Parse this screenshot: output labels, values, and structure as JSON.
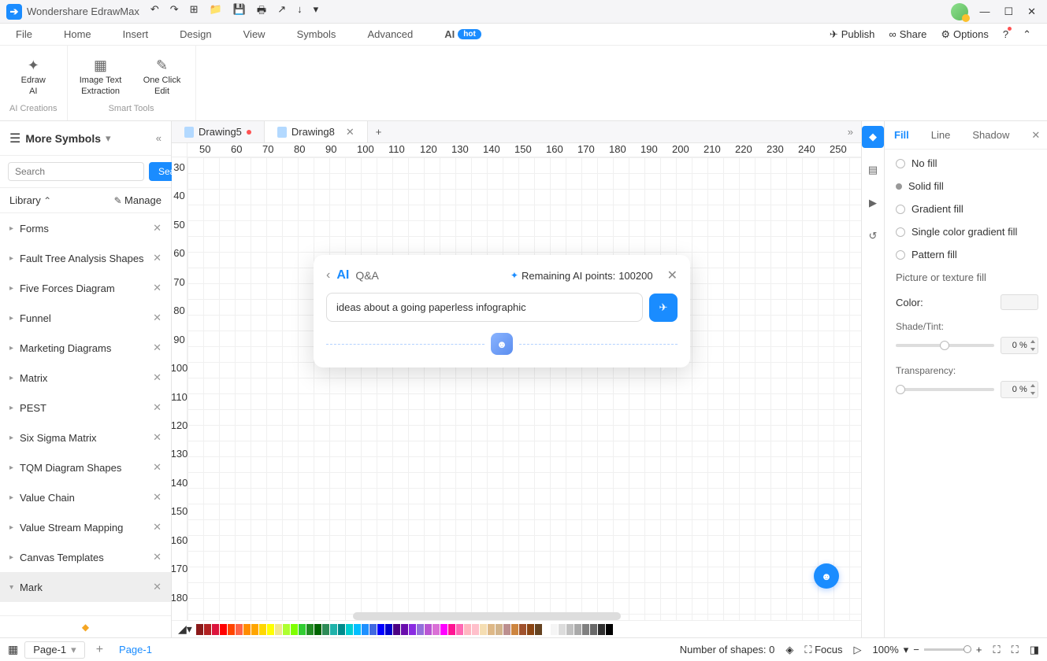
{
  "app": {
    "title": "Wondershare EdrawMax"
  },
  "menus": {
    "file": "File",
    "home": "Home",
    "insert": "Insert",
    "design": "Design",
    "view": "View",
    "symbols": "Symbols",
    "advanced": "Advanced",
    "ai": "AI",
    "hot": "hot"
  },
  "topright": {
    "publish": "Publish",
    "share": "Share",
    "options": "Options"
  },
  "ribbon": {
    "groups": [
      {
        "label": "AI Creations",
        "tools": [
          {
            "name": "edraw-ai",
            "label": "Edraw\nAI"
          }
        ]
      },
      {
        "label": "Smart Tools",
        "tools": [
          {
            "name": "image-text",
            "label": "Image Text\nExtraction"
          },
          {
            "name": "one-click",
            "label": "One Click\nEdit"
          }
        ]
      }
    ]
  },
  "leftpanel": {
    "title": "More Symbols",
    "search_placeholder": "Search",
    "search_btn": "Search",
    "library": "Library",
    "manage": "Manage",
    "items": [
      {
        "label": "Forms"
      },
      {
        "label": "Fault Tree Analysis Shapes"
      },
      {
        "label": "Five Forces Diagram"
      },
      {
        "label": "Funnel"
      },
      {
        "label": "Marketing Diagrams"
      },
      {
        "label": "Matrix"
      },
      {
        "label": "PEST"
      },
      {
        "label": "Six Sigma Matrix"
      },
      {
        "label": "TQM Diagram Shapes"
      },
      {
        "label": "Value Chain"
      },
      {
        "label": "Value Stream Mapping"
      },
      {
        "label": "Canvas Templates"
      },
      {
        "label": "Mark",
        "selected": true
      }
    ]
  },
  "tabs": [
    {
      "label": "Drawing5",
      "dirty": true
    },
    {
      "label": "Drawing8",
      "active": true
    }
  ],
  "ruler_h": [
    "50",
    "60",
    "70",
    "80",
    "90",
    "100",
    "110",
    "120",
    "130",
    "140",
    "150",
    "160",
    "170",
    "180",
    "190",
    "200",
    "210",
    "220",
    "230",
    "240",
    "250"
  ],
  "ruler_v": [
    "30",
    "40",
    "50",
    "60",
    "70",
    "80",
    "90",
    "100",
    "110",
    "120",
    "130",
    "140",
    "150",
    "160",
    "170",
    "180"
  ],
  "ai_dialog": {
    "ai": "AI",
    "qa": "Q&A",
    "points_label": "Remaining AI points:",
    "points_value": "100200",
    "input": "ideas about a going paperless infographic"
  },
  "rightpanel": {
    "tabs": {
      "fill": "Fill",
      "line": "Line",
      "shadow": "Shadow"
    },
    "fill_options": [
      "No fill",
      "Solid fill",
      "Gradient fill",
      "Single color gradient fill",
      "Pattern fill",
      "Picture or texture fill"
    ],
    "color": "Color:",
    "shade": "Shade/Tint:",
    "shade_val": "0 %",
    "transp": "Transparency:",
    "transp_val": "0 %"
  },
  "color_swatches": [
    "#8b1a1a",
    "#b22222",
    "#dc143c",
    "#ff0000",
    "#ff4500",
    "#ff6347",
    "#ff8c00",
    "#ffa500",
    "#ffd700",
    "#ffff00",
    "#f0e68c",
    "#adff2f",
    "#7fff00",
    "#32cd32",
    "#228b22",
    "#006400",
    "#2e8b57",
    "#20b2aa",
    "#008b8b",
    "#00ced1",
    "#00bfff",
    "#1e90ff",
    "#4169e1",
    "#0000ff",
    "#0000cd",
    "#4b0082",
    "#6a0dad",
    "#8a2be2",
    "#9370db",
    "#ba55d3",
    "#da70d6",
    "#ff00ff",
    "#ff1493",
    "#ff69b4",
    "#ffb6c1",
    "#ffc0cb",
    "#f5deb3",
    "#deb887",
    "#d2b48c",
    "#bc8f8f",
    "#cd853f",
    "#a0522d",
    "#8b4513",
    "#654321",
    "#ffffff",
    "#f5f5f5",
    "#dcdcdc",
    "#c0c0c0",
    "#a9a9a9",
    "#808080",
    "#696969",
    "#2f2f2f",
    "#000000"
  ],
  "status": {
    "page": "Page-1",
    "page_link": "Page-1",
    "shapes": "Number of shapes: 0",
    "focus": "Focus",
    "zoom": "100%"
  }
}
